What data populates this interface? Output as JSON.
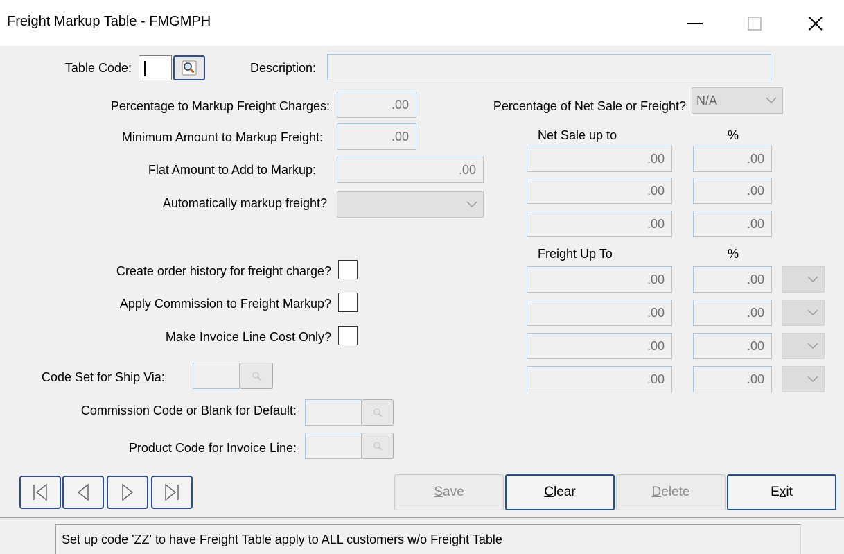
{
  "window": {
    "title": "Freight Markup Table - FMGMPH"
  },
  "form": {
    "table_code_label": "Table Code:",
    "description_label": "Description:",
    "pct_markup_label": "Percentage to Markup Freight Charges:",
    "pct_markup_value": ".00",
    "min_amount_label": "Minimum Amount to Markup Freight:",
    "min_amount_value": ".00",
    "flat_amount_label": "Flat Amount to Add to Markup:",
    "flat_amount_value": ".00",
    "auto_markup_label": "Automatically markup freight?",
    "pct_net_sale_label": "Percentage of Net Sale or Freight?",
    "pct_net_sale_value": "N/A",
    "create_history_label": "Create order history for freight charge?",
    "apply_commission_label": "Apply Commission to Freight Markup?",
    "invoice_cost_only_label": "Make Invoice Line Cost Only?",
    "code_set_label": "Code Set for Ship Via:",
    "commission_code_label": "Commission Code or Blank for Default:",
    "product_code_label": "Product Code for Invoice Line:"
  },
  "net_sale": {
    "header": "Net Sale up to",
    "pct_header": "%",
    "rows": [
      {
        "amount": ".00",
        "pct": ".00"
      },
      {
        "amount": ".00",
        "pct": ".00"
      },
      {
        "amount": ".00",
        "pct": ".00"
      }
    ]
  },
  "freight": {
    "header": "Freight Up To",
    "pct_header": "%",
    "rows": [
      {
        "amount": ".00",
        "pct": ".00"
      },
      {
        "amount": ".00",
        "pct": ".00"
      },
      {
        "amount": ".00",
        "pct": ".00"
      },
      {
        "amount": ".00",
        "pct": ".00"
      }
    ]
  },
  "buttons": {
    "save_a": "S",
    "save_b": "ave",
    "clear_a": "C",
    "clear_b": "lear",
    "delete_a": "D",
    "delete_b": "elete",
    "exit_a": "E",
    "exit_b": "x",
    "exit_c": "it"
  },
  "status": {
    "message": "Set up code 'ZZ' to have Freight Table apply to ALL customers w/o Freight Table"
  },
  "colors": {
    "button_border": "#20508c",
    "field_border": "#a9c4db",
    "disabled_text": "#8a8a8a"
  }
}
